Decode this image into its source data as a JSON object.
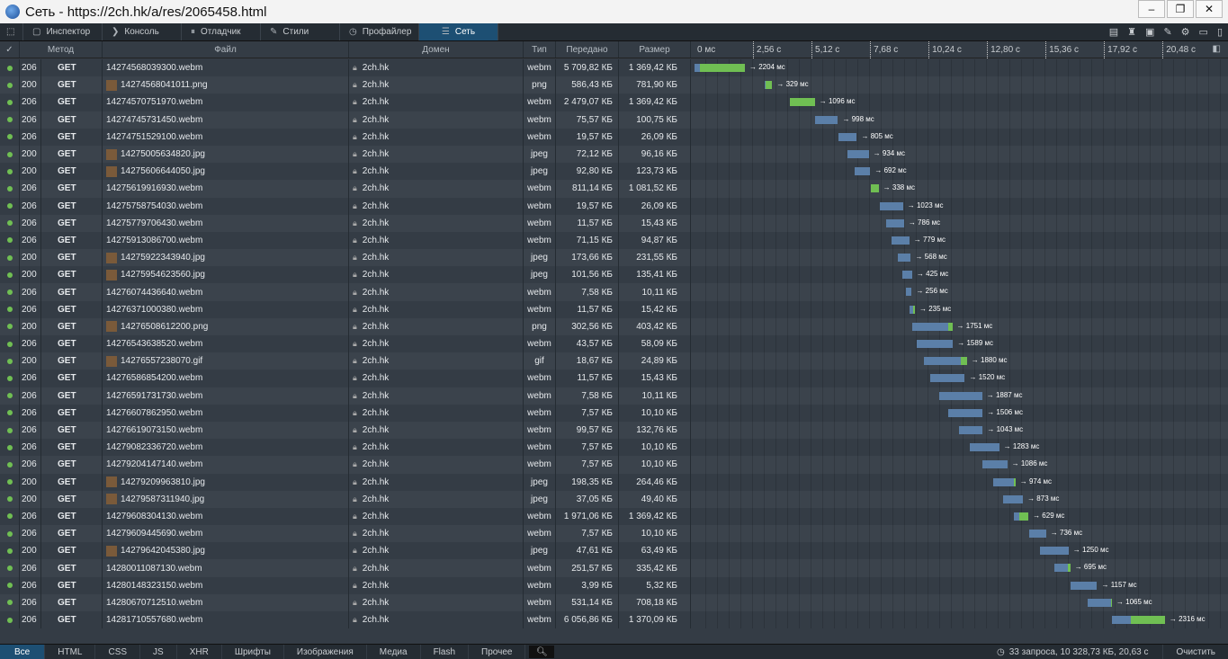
{
  "window": {
    "title": "Сеть - https://2ch.hk/a/res/2065458.html"
  },
  "tabs": [
    {
      "label": "Инспектор",
      "icon": "inspector-icon"
    },
    {
      "label": "Консоль",
      "icon": "console-icon"
    },
    {
      "label": "Отладчик",
      "icon": "debugger-icon"
    },
    {
      "label": "Стили",
      "icon": "style-icon"
    },
    {
      "label": "Профайлер",
      "icon": "profiler-icon"
    },
    {
      "label": "Сеть",
      "icon": "network-icon",
      "selected": true
    }
  ],
  "columns": {
    "status": "✓",
    "method": "Метод",
    "file": "Файл",
    "domain": "Домен",
    "type": "Тип",
    "transferred": "Передано",
    "size": "Размер"
  },
  "timeline_ticks": [
    "0 мс",
    "2,56 с",
    "5,12 с",
    "7,68 с",
    "10,24 с",
    "12,80 с",
    "15,36 с",
    "17,92 с",
    "20,48 с"
  ],
  "requests": [
    {
      "status": "206",
      "method": "GET",
      "file": "14274568039300.webm",
      "domain": "2ch.hk",
      "type": "webm",
      "transferred": "5 709,82 КБ",
      "size": "1 369,42 КБ",
      "start_s": 0,
      "duration": "2204 мс",
      "ms": 2204,
      "recv": 0.9,
      "thumb": false
    },
    {
      "status": "200",
      "method": "GET",
      "file": "14274568041011.png",
      "domain": "2ch.hk",
      "type": "png",
      "transferred": "586,43 КБ",
      "size": "781,90 КБ",
      "start_s": 3.07,
      "duration": "329 мс",
      "ms": 329,
      "recv": 0.9,
      "thumb": true
    },
    {
      "status": "206",
      "method": "GET",
      "file": "14274570751970.webm",
      "domain": "2ch.hk",
      "type": "webm",
      "transferred": "2 479,07 КБ",
      "size": "1 369,42 КБ",
      "start_s": 4.17,
      "duration": "1096 мс",
      "ms": 1096,
      "recv": 1,
      "thumb": false
    },
    {
      "status": "206",
      "method": "GET",
      "file": "14274745731450.webm",
      "domain": "2ch.hk",
      "type": "webm",
      "transferred": "75,57 КБ",
      "size": "100,75 КБ",
      "start_s": 5.28,
      "duration": "998 мс",
      "ms": 998,
      "recv": 0,
      "thumb": false
    },
    {
      "status": "206",
      "method": "GET",
      "file": "14274751529100.webm",
      "domain": "2ch.hk",
      "type": "webm",
      "transferred": "19,57 КБ",
      "size": "26,09 КБ",
      "start_s": 6.3,
      "duration": "805 мс",
      "ms": 805,
      "recv": 0,
      "thumb": false
    },
    {
      "status": "200",
      "method": "GET",
      "file": "14275005634820.jpg",
      "domain": "2ch.hk",
      "type": "jpeg",
      "transferred": "72,12 КБ",
      "size": "96,16 КБ",
      "start_s": 6.69,
      "duration": "934 мс",
      "ms": 934,
      "recv": 0,
      "thumb": true
    },
    {
      "status": "200",
      "method": "GET",
      "file": "14275606644050.jpg",
      "domain": "2ch.hk",
      "type": "jpeg",
      "transferred": "92,80 КБ",
      "size": "123,73 КБ",
      "start_s": 7.0,
      "duration": "692 мс",
      "ms": 692,
      "recv": 0,
      "thumb": true
    },
    {
      "status": "206",
      "method": "GET",
      "file": "14275619916930.webm",
      "domain": "2ch.hk",
      "type": "webm",
      "transferred": "811,14 КБ",
      "size": "1 081,52 КБ",
      "start_s": 7.72,
      "duration": "338 мс",
      "ms": 338,
      "recv": 1,
      "thumb": false
    },
    {
      "status": "206",
      "method": "GET",
      "file": "14275758754030.webm",
      "domain": "2ch.hk",
      "type": "webm",
      "transferred": "19,57 КБ",
      "size": "26,09 КБ",
      "start_s": 8.1,
      "duration": "1023 мс",
      "ms": 1023,
      "recv": 0,
      "thumb": false
    },
    {
      "status": "206",
      "method": "GET",
      "file": "14275779706430.webm",
      "domain": "2ch.hk",
      "type": "webm",
      "transferred": "11,57 КБ",
      "size": "15,43 КБ",
      "start_s": 8.38,
      "duration": "786 мс",
      "ms": 786,
      "recv": 0,
      "thumb": false
    },
    {
      "status": "206",
      "method": "GET",
      "file": "14275913086700.webm",
      "domain": "2ch.hk",
      "type": "webm",
      "transferred": "71,15 КБ",
      "size": "94,87 КБ",
      "start_s": 8.62,
      "duration": "779 мс",
      "ms": 779,
      "recv": 0,
      "thumb": false
    },
    {
      "status": "200",
      "method": "GET",
      "file": "14275922343940.jpg",
      "domain": "2ch.hk",
      "type": "jpeg",
      "transferred": "173,66 КБ",
      "size": "231,55 КБ",
      "start_s": 8.9,
      "duration": "568 мс",
      "ms": 568,
      "recv": 0,
      "thumb": true
    },
    {
      "status": "200",
      "method": "GET",
      "file": "14275954623560.jpg",
      "domain": "2ch.hk",
      "type": "jpeg",
      "transferred": "101,56 КБ",
      "size": "135,41 КБ",
      "start_s": 9.1,
      "duration": "425 мс",
      "ms": 425,
      "recv": 0,
      "thumb": true
    },
    {
      "status": "206",
      "method": "GET",
      "file": "14276074436640.webm",
      "domain": "2ch.hk",
      "type": "webm",
      "transferred": "7,58 КБ",
      "size": "10,11 КБ",
      "start_s": 9.25,
      "duration": "256 мс",
      "ms": 256,
      "recv": 0,
      "thumb": false
    },
    {
      "status": "206",
      "method": "GET",
      "file": "14276371000380.webm",
      "domain": "2ch.hk",
      "type": "webm",
      "transferred": "11,57 КБ",
      "size": "15,42 КБ",
      "start_s": 9.41,
      "duration": "235 мс",
      "ms": 235,
      "recv": 0.4,
      "thumb": false
    },
    {
      "status": "200",
      "method": "GET",
      "file": "14276508612200.png",
      "domain": "2ch.hk",
      "type": "png",
      "transferred": "302,56 КБ",
      "size": "403,42 КБ",
      "start_s": 9.53,
      "duration": "1751 мс",
      "ms": 1751,
      "recv": 0.1,
      "thumb": true
    },
    {
      "status": "206",
      "method": "GET",
      "file": "14276543638520.webm",
      "domain": "2ch.hk",
      "type": "webm",
      "transferred": "43,57 КБ",
      "size": "58,09 КБ",
      "start_s": 9.72,
      "duration": "1589 мс",
      "ms": 1589,
      "recv": 0,
      "thumb": false
    },
    {
      "status": "200",
      "method": "GET",
      "file": "14276557238070.gif",
      "domain": "2ch.hk",
      "type": "gif",
      "transferred": "18,67 КБ",
      "size": "24,89 КБ",
      "start_s": 10.04,
      "duration": "1880 мс",
      "ms": 1880,
      "recv": 0.15,
      "thumb": true
    },
    {
      "status": "206",
      "method": "GET",
      "file": "14276586854200.webm",
      "domain": "2ch.hk",
      "type": "webm",
      "transferred": "11,57 КБ",
      "size": "15,43 КБ",
      "start_s": 10.31,
      "duration": "1520 мс",
      "ms": 1520,
      "recv": 0,
      "thumb": false
    },
    {
      "status": "206",
      "method": "GET",
      "file": "14276591731730.webm",
      "domain": "2ch.hk",
      "type": "webm",
      "transferred": "7,58 КБ",
      "size": "10,11 КБ",
      "start_s": 10.7,
      "duration": "1887 мс",
      "ms": 1887,
      "recv": 0,
      "thumb": false
    },
    {
      "status": "206",
      "method": "GET",
      "file": "14276607862950.webm",
      "domain": "2ch.hk",
      "type": "webm",
      "transferred": "7,57 КБ",
      "size": "10,10 КБ",
      "start_s": 11.1,
      "duration": "1506 мс",
      "ms": 1506,
      "recv": 0,
      "thumb": false
    },
    {
      "status": "206",
      "method": "GET",
      "file": "14276619073150.webm",
      "domain": "2ch.hk",
      "type": "webm",
      "transferred": "99,57 КБ",
      "size": "132,76 КБ",
      "start_s": 11.57,
      "duration": "1043 мс",
      "ms": 1043,
      "recv": 0,
      "thumb": false
    },
    {
      "status": "206",
      "method": "GET",
      "file": "14279082336720.webm",
      "domain": "2ch.hk",
      "type": "webm",
      "transferred": "7,57 КБ",
      "size": "10,10 КБ",
      "start_s": 12.05,
      "duration": "1283 мс",
      "ms": 1283,
      "recv": 0,
      "thumb": false
    },
    {
      "status": "206",
      "method": "GET",
      "file": "14279204147140.webm",
      "domain": "2ch.hk",
      "type": "webm",
      "transferred": "7,57 КБ",
      "size": "10,10 КБ",
      "start_s": 12.6,
      "duration": "1086 мс",
      "ms": 1086,
      "recv": 0,
      "thumb": false
    },
    {
      "status": "200",
      "method": "GET",
      "file": "14279209963810.jpg",
      "domain": "2ch.hk",
      "type": "jpeg",
      "transferred": "198,35 КБ",
      "size": "264,46 КБ",
      "start_s": 13.07,
      "duration": "974 мс",
      "ms": 974,
      "recv": 0.05,
      "thumb": true
    },
    {
      "status": "200",
      "method": "GET",
      "file": "14279587311940.jpg",
      "domain": "2ch.hk",
      "type": "jpeg",
      "transferred": "37,05 КБ",
      "size": "49,40 КБ",
      "start_s": 13.5,
      "duration": "873 мс",
      "ms": 873,
      "recv": 0,
      "thumb": true
    },
    {
      "status": "206",
      "method": "GET",
      "file": "14279608304130.webm",
      "domain": "2ch.hk",
      "type": "webm",
      "transferred": "1 971,06 КБ",
      "size": "1 369,42 КБ",
      "start_s": 13.98,
      "duration": "629 мс",
      "ms": 629,
      "recv": 0.6,
      "thumb": false
    },
    {
      "status": "206",
      "method": "GET",
      "file": "14279609445690.webm",
      "domain": "2ch.hk",
      "type": "webm",
      "transferred": "7,57 КБ",
      "size": "10,10 КБ",
      "start_s": 14.65,
      "duration": "736 мс",
      "ms": 736,
      "recv": 0,
      "thumb": false
    },
    {
      "status": "200",
      "method": "GET",
      "file": "14279642045380.jpg",
      "domain": "2ch.hk",
      "type": "jpeg",
      "transferred": "47,61 КБ",
      "size": "63,49 КБ",
      "start_s": 15.12,
      "duration": "1250 мс",
      "ms": 1250,
      "recv": 0,
      "thumb": true
    },
    {
      "status": "206",
      "method": "GET",
      "file": "14280011087130.webm",
      "domain": "2ch.hk",
      "type": "webm",
      "transferred": "251,57 КБ",
      "size": "335,42 КБ",
      "start_s": 15.75,
      "duration": "695 мс",
      "ms": 695,
      "recv": 0.15,
      "thumb": false
    },
    {
      "status": "206",
      "method": "GET",
      "file": "14280148323150.webm",
      "domain": "2ch.hk",
      "type": "webm",
      "transferred": "3,99 КБ",
      "size": "5,32 КБ",
      "start_s": 16.46,
      "duration": "1157 мс",
      "ms": 1157,
      "recv": 0,
      "thumb": false
    },
    {
      "status": "206",
      "method": "GET",
      "file": "14280670712510.webm",
      "domain": "2ch.hk",
      "type": "webm",
      "transferred": "531,14 КБ",
      "size": "708,18 КБ",
      "start_s": 17.2,
      "duration": "1065 мс",
      "ms": 1065,
      "recv": 0.05,
      "thumb": false
    },
    {
      "status": "206",
      "method": "GET",
      "file": "14281710557680.webm",
      "domain": "2ch.hk",
      "type": "webm",
      "transferred": "6 056,86 КБ",
      "size": "1 370,09 КБ",
      "start_s": 18.27,
      "duration": "2316 мс",
      "ms": 2316,
      "recv": 0.65,
      "thumb": false
    }
  ],
  "filters": [
    "Все",
    "HTML",
    "CSS",
    "JS",
    "XHR",
    "Шрифты",
    "Изображения",
    "Медиа",
    "Flash",
    "Прочее"
  ],
  "summary": "33 запроса, 10 328,73 КБ, 20,63 с",
  "clear_label": "Очистить",
  "colors": {
    "waiting": "#5b7fa8",
    "receiving": "#70bf53",
    "selected": "#1d4f73"
  }
}
